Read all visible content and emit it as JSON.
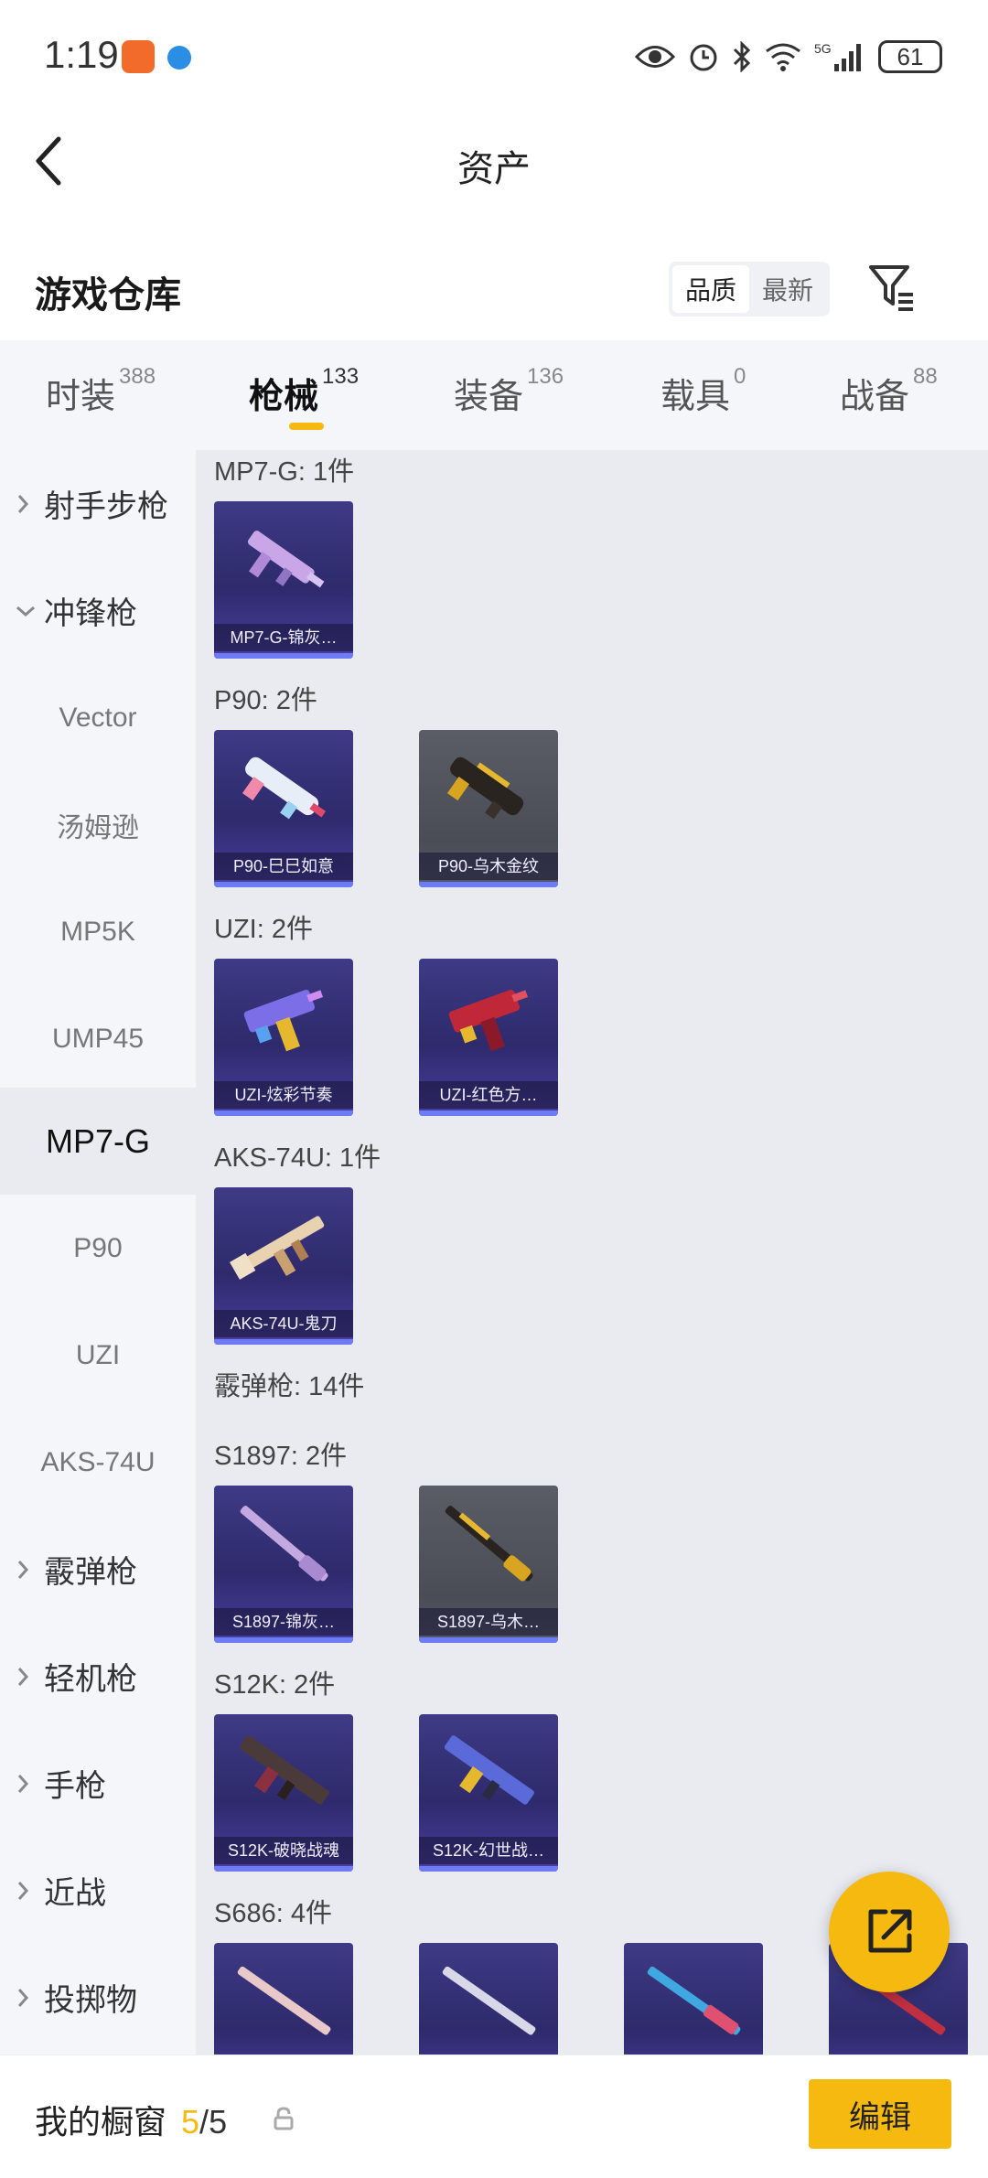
{
  "status_bar": {
    "time": "1:19",
    "battery": "61"
  },
  "header": {
    "title": "资产"
  },
  "warehouse": {
    "title": "游戏仓库",
    "sort_options": [
      "品质",
      "最新"
    ]
  },
  "tabs": [
    {
      "label": "时装",
      "count": "388"
    },
    {
      "label": "枪械",
      "count": "133"
    },
    {
      "label": "装备",
      "count": "136"
    },
    {
      "label": "载具",
      "count": "0"
    },
    {
      "label": "战备",
      "count": "88"
    }
  ],
  "sidebar": {
    "items": [
      {
        "label": "射手步枪",
        "type": "category"
      },
      {
        "label": "冲锋枪",
        "type": "category-open"
      },
      {
        "label": "Vector",
        "type": "sub"
      },
      {
        "label": "汤姆逊",
        "type": "sub"
      },
      {
        "label": "MP5K",
        "type": "sub"
      },
      {
        "label": "UMP45",
        "type": "sub"
      },
      {
        "label": "MP7-G",
        "type": "selected"
      },
      {
        "label": "P90",
        "type": "sub"
      },
      {
        "label": "UZI",
        "type": "sub"
      },
      {
        "label": "AKS-74U",
        "type": "sub"
      },
      {
        "label": "霰弹枪",
        "type": "category"
      },
      {
        "label": "轻机枪",
        "type": "category"
      },
      {
        "label": "手枪",
        "type": "category"
      },
      {
        "label": "近战",
        "type": "category"
      },
      {
        "label": "投掷物",
        "type": "category"
      }
    ]
  },
  "content": {
    "groups": [
      {
        "label": "MP7-G: 1件",
        "items": [
          {
            "name": "MP7-G-锦灰…",
            "style": "purple"
          }
        ]
      },
      {
        "label": "P90: 2件",
        "items": [
          {
            "name": "P90-巳巳如意",
            "style": "purple"
          },
          {
            "name": "P90-乌木金纹",
            "style": "gray"
          }
        ]
      },
      {
        "label": "UZI: 2件",
        "items": [
          {
            "name": "UZI-炫彩节奏",
            "style": "purple"
          },
          {
            "name": "UZI-红色方…",
            "style": "purple"
          }
        ]
      },
      {
        "label": "AKS-74U: 1件",
        "items": [
          {
            "name": "AKS-74U-鬼刀",
            "style": "purple"
          }
        ]
      },
      {
        "label": "霰弹枪: 14件",
        "items": []
      },
      {
        "label": "S1897: 2件",
        "items": [
          {
            "name": "S1897-锦灰…",
            "style": "purple"
          },
          {
            "name": "S1897-乌木…",
            "style": "gray"
          }
        ]
      },
      {
        "label": "S12K: 2件",
        "items": [
          {
            "name": "S12K-破晓战魂",
            "style": "purple"
          },
          {
            "name": "S12K-幻世战…",
            "style": "purple"
          }
        ]
      },
      {
        "label": "S686: 4件",
        "items": [
          {
            "name": "",
            "style": "purple"
          },
          {
            "name": "",
            "style": "purple"
          },
          {
            "name": "",
            "style": "purple"
          },
          {
            "name": "",
            "style": "purple"
          }
        ]
      }
    ]
  },
  "bottom_bar": {
    "label": "我的橱窗",
    "current": "5",
    "separator": "/",
    "max": "5",
    "edit_label": "编辑"
  },
  "colors": {
    "accent": "#f6b90f",
    "card_purple": "#3e3a85",
    "card_gray": "#55585f"
  },
  "icons": [
    "back-arrow-icon",
    "filter-icon",
    "chevron-right-icon",
    "chevron-down-icon",
    "share-icon",
    "lock-icon"
  ]
}
